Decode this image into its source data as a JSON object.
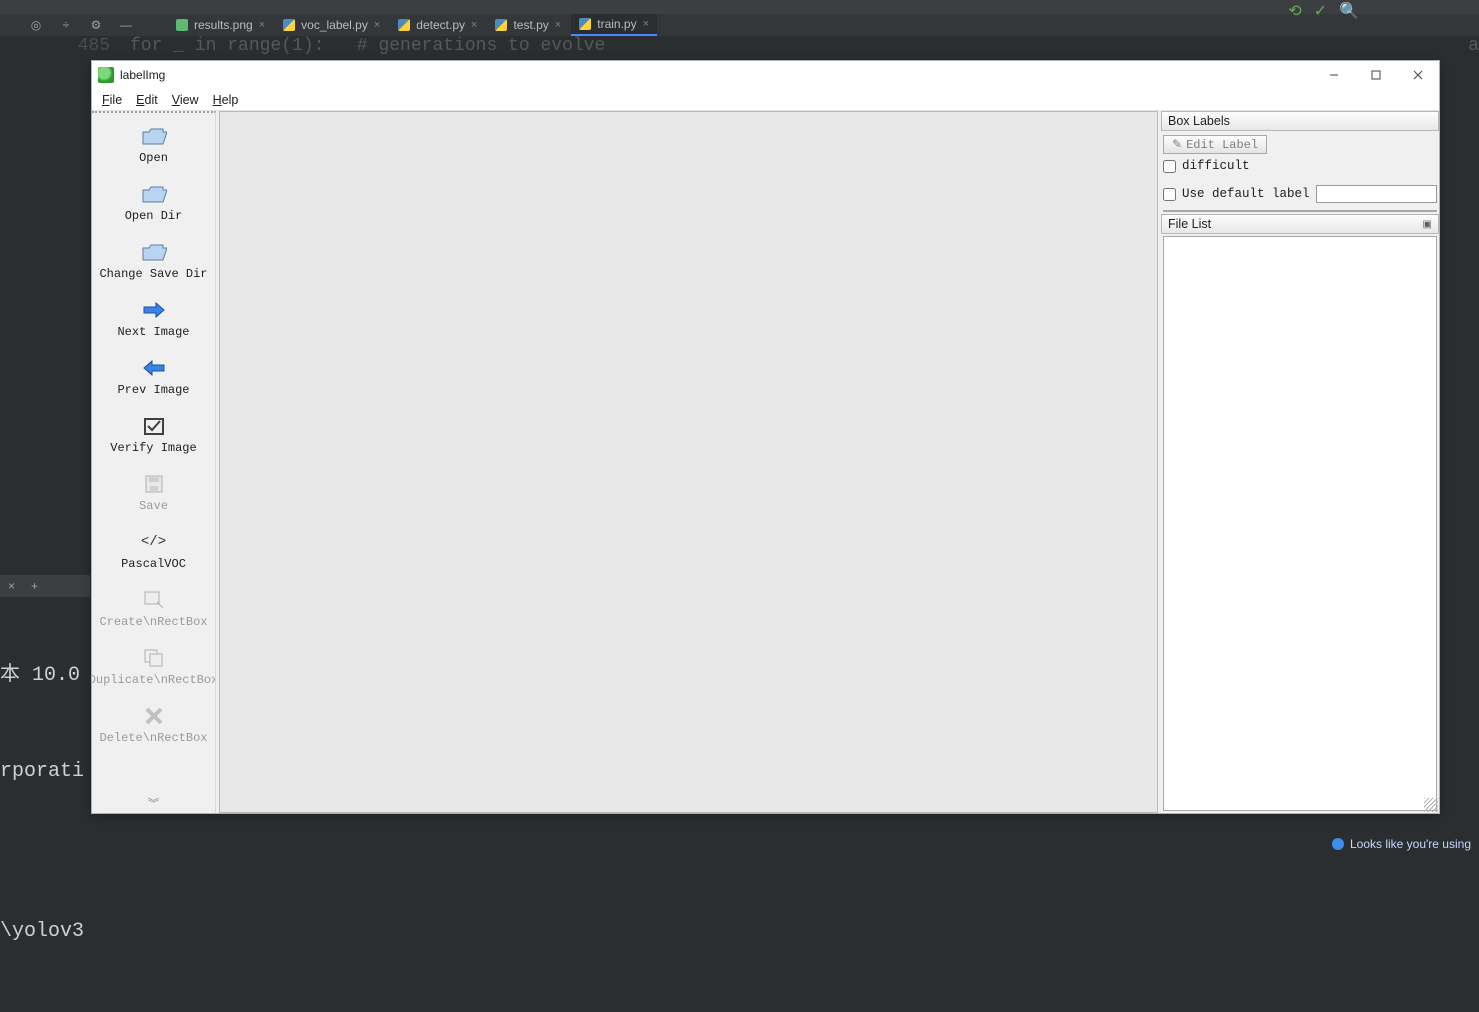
{
  "ide": {
    "tabs": [
      {
        "label": "results.png",
        "kind": "img"
      },
      {
        "label": "voc_label.py",
        "kind": "py"
      },
      {
        "label": "detect.py",
        "kind": "py"
      },
      {
        "label": "test.py",
        "kind": "py"
      },
      {
        "label": "train.py",
        "kind": "py",
        "active": true
      }
    ],
    "gutter_line": "485",
    "code_line": "for _ in range(1):   # generations to evolve",
    "code_trail": "a",
    "terminal_tab_close": "×",
    "terminal_newtab": "+",
    "terminal_lines": [
      "本 10.0",
      "rporati",
      "",
      "\\yolov3"
    ],
    "status_hint": "Looks like you're using"
  },
  "app": {
    "title": "labelImg",
    "menus": {
      "file": "File",
      "edit": "Edit",
      "view": "View",
      "help": "Help"
    },
    "toolbar": {
      "open": "Open",
      "open_dir": "Open Dir",
      "change_save_dir": "Change Save Dir",
      "next_image": "Next Image",
      "prev_image": "Prev Image",
      "verify_image": "Verify Image",
      "save": "Save",
      "format": "PascalVOC",
      "create_box": "Create\\nRectBox",
      "duplicate_box": "Duplicate\\nRectBox",
      "delete_box": "Delete\\nRectBox"
    },
    "right": {
      "box_labels_title": "Box Labels",
      "edit_label_btn": "Edit Label",
      "difficult_label": "difficult",
      "use_default_label": "Use default label",
      "default_label_value": "",
      "file_list_title": "File List"
    }
  }
}
